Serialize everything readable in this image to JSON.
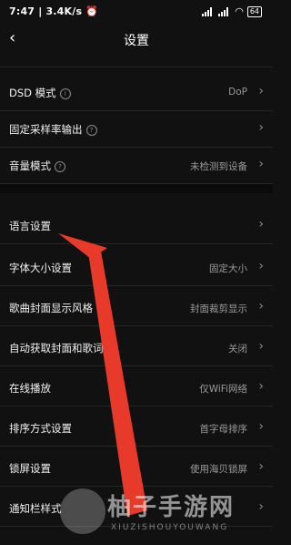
{
  "status": {
    "time": "7:47",
    "speed": "3.4K/s",
    "battery": "64"
  },
  "header": {
    "title": "设置",
    "back_glyph": "‹"
  },
  "rows": [
    {
      "label": "DSD 模式",
      "value": "DoP",
      "info": true
    },
    {
      "label": "固定采样率输出",
      "value": "",
      "info": true
    },
    {
      "label": "音量模式",
      "value": "未检测到设备",
      "info": true
    },
    {
      "label": "语言设置",
      "value": "",
      "info": false
    },
    {
      "label": "字体大小设置",
      "value": "固定大小",
      "info": false
    },
    {
      "label": "歌曲封面显示风格",
      "value": "封面裁剪显示",
      "info": false
    },
    {
      "label": "自动获取封面和歌词",
      "value": "关闭",
      "info": false
    },
    {
      "label": "在线播放",
      "value": "仅WiFi网络",
      "info": false
    },
    {
      "label": "排序方式设置",
      "value": "首字母排序",
      "info": false
    },
    {
      "label": "锁屏设置",
      "value": "使用海贝锁屏",
      "info": false
    },
    {
      "label": "通知栏样式",
      "value": "",
      "info": false
    }
  ],
  "watermark": {
    "cn": "柚子手游网",
    "en": "XIUZISHOUYOUWANG"
  },
  "colors": {
    "background": "#111111",
    "arrow": "#e83a2a",
    "divider": "#262626",
    "value_text": "#9a9a9a"
  }
}
